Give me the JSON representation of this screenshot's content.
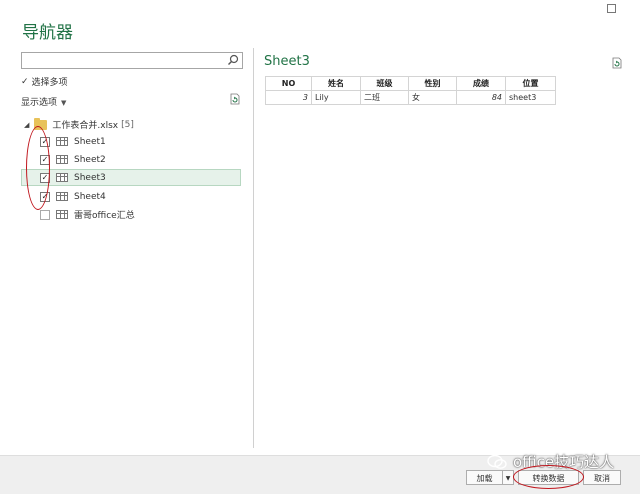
{
  "window": {
    "title": "导航器",
    "close_glyph": "☐"
  },
  "search": {
    "value": "",
    "placeholder": ""
  },
  "select_multiple": {
    "label": "选择多项",
    "checked": true
  },
  "display_options": {
    "label": "显示选项"
  },
  "tree": {
    "root": {
      "label": "工作表合并.xlsx",
      "count": "[5]"
    },
    "items": [
      {
        "label": "Sheet1",
        "checked": "✓"
      },
      {
        "label": "Sheet2",
        "checked": "✓"
      },
      {
        "label": "Sheet3",
        "checked": "✓"
      },
      {
        "label": "Sheet4",
        "checked": "✓"
      },
      {
        "label": "雷哥office汇总",
        "checked": ""
      }
    ]
  },
  "preview": {
    "title": "Sheet3",
    "columns": [
      "NO",
      "姓名",
      "班级",
      "性别",
      "成绩",
      "位置"
    ],
    "rows": [
      [
        "3",
        "Lily",
        "二班",
        "女",
        "84",
        "sheet3"
      ]
    ]
  },
  "buttons": {
    "load": "加载",
    "transform": "转换数据",
    "cancel": "取消"
  },
  "watermark": {
    "text": "office技巧达人"
  },
  "colors": {
    "accent": "#217346",
    "annotation": "#c0161d"
  }
}
